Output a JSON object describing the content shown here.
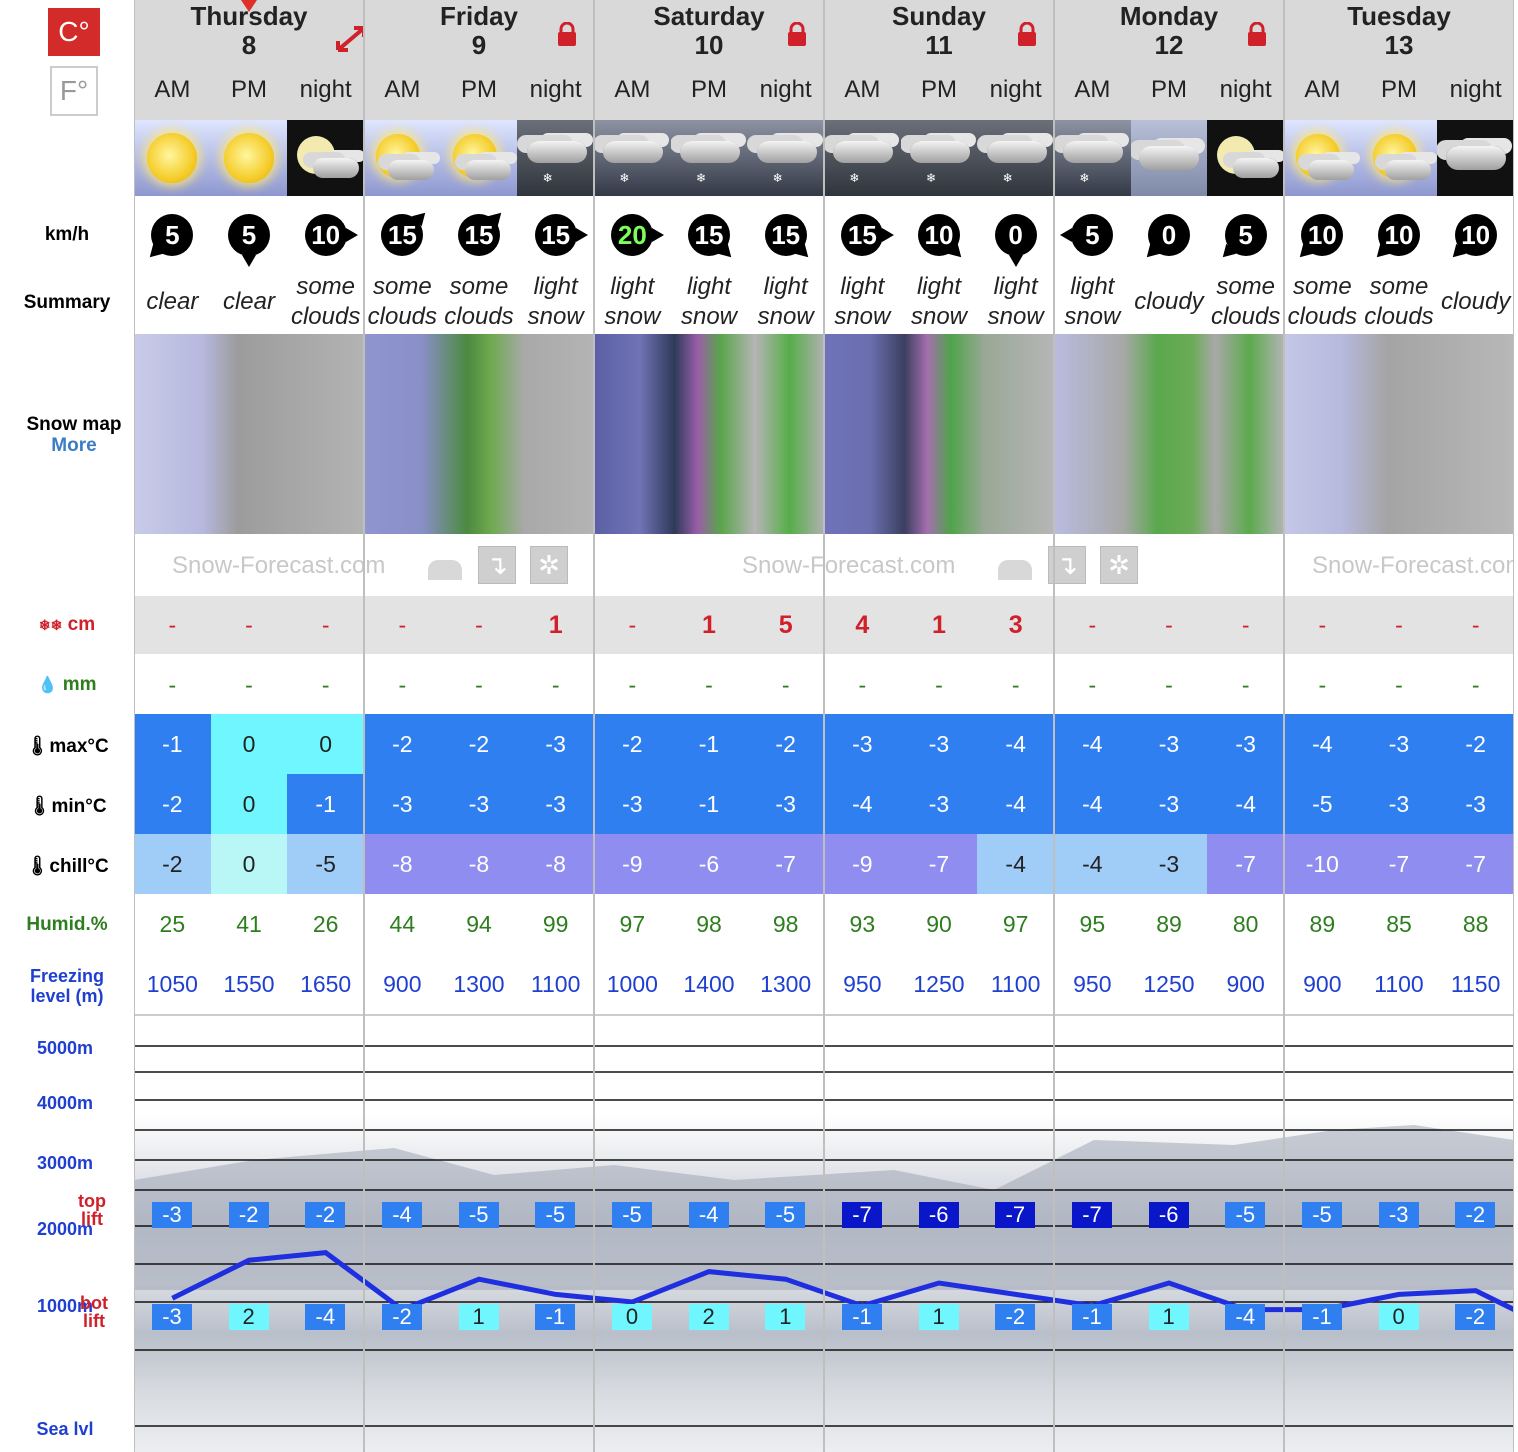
{
  "units": {
    "celsius": "C°",
    "fahrenheit": "F°"
  },
  "labels": {
    "wind": "km/h",
    "summary": "Summary",
    "snow_map": "Snow map",
    "more": "More",
    "snow_cm": "cm",
    "rain_mm": "mm",
    "max": "max°C",
    "min": "min°C",
    "chill": "chill°C",
    "humid": "Humid.%",
    "freezing_1": "Freezing",
    "freezing_2": "level (m)",
    "alt_5000": "5000m",
    "alt_4000": "4000m",
    "alt_3000": "3000m",
    "alt_2000": "2000m",
    "alt_1000": "1000m",
    "alt_sea": "Sea lvl",
    "top": "top",
    "lift": "lift",
    "bot": "bot",
    "bot_lift": "lift"
  },
  "watermark": "Snow-Forecast.com",
  "days": [
    {
      "name": "Thursday",
      "date": "8",
      "locked": false
    },
    {
      "name": "Friday",
      "date": "9",
      "locked": true
    },
    {
      "name": "Saturday",
      "date": "10",
      "locked": true
    },
    {
      "name": "Sunday",
      "date": "11",
      "locked": true
    },
    {
      "name": "Monday",
      "date": "12",
      "locked": true
    },
    {
      "name": "Tuesday",
      "date": "13",
      "locked": false
    }
  ],
  "periods": [
    "AM",
    "PM",
    "night"
  ],
  "weather_icons": [
    "sun-icon",
    "sun-icon",
    "moon-cloud-icon",
    "sun-cloud-icon",
    "sun-cloud-icon",
    "snow-cloud-icon",
    "snow-cloud-icon",
    "snow-cloud-icon",
    "snow-cloud-icon",
    "snow-cloud-icon",
    "snow-cloud-icon",
    "snow-cloud-icon",
    "snow-cloud-icon",
    "cloud-icon",
    "moon-cloud-icon",
    "sun-cloud-icon",
    "sun-cloud-icon",
    "cloud-icon"
  ],
  "wind": [
    {
      "speed": "5",
      "dir": "sw"
    },
    {
      "speed": "5",
      "dir": "s"
    },
    {
      "speed": "10",
      "dir": "e"
    },
    {
      "speed": "15",
      "dir": "ne"
    },
    {
      "speed": "15",
      "dir": "ne"
    },
    {
      "speed": "15",
      "dir": "e"
    },
    {
      "speed": "20",
      "dir": "e"
    },
    {
      "speed": "15",
      "dir": "se"
    },
    {
      "speed": "15",
      "dir": "se"
    },
    {
      "speed": "15",
      "dir": "e"
    },
    {
      "speed": "10",
      "dir": "se"
    },
    {
      "speed": "0",
      "dir": "s"
    },
    {
      "speed": "5",
      "dir": "w"
    },
    {
      "speed": "0",
      "dir": "sw"
    },
    {
      "speed": "5",
      "dir": "sw"
    },
    {
      "speed": "10",
      "dir": "sw"
    },
    {
      "speed": "10",
      "dir": "sw"
    },
    {
      "speed": "10",
      "dir": "sw"
    }
  ],
  "summary": [
    [
      "clear"
    ],
    [
      "clear"
    ],
    [
      "some",
      "clouds"
    ],
    [
      "some",
      "clouds"
    ],
    [
      "some",
      "clouds"
    ],
    [
      "light",
      "snow"
    ],
    [
      "light",
      "snow"
    ],
    [
      "light",
      "snow"
    ],
    [
      "light",
      "snow"
    ],
    [
      "light",
      "snow"
    ],
    [
      "light",
      "snow"
    ],
    [
      "light",
      "snow"
    ],
    [
      "light",
      "snow"
    ],
    [
      "cloudy"
    ],
    [
      "some",
      "clouds"
    ],
    [
      "some",
      "clouds"
    ],
    [
      "some",
      "clouds"
    ],
    [
      "cloudy"
    ]
  ],
  "snow_cm": [
    "-",
    "-",
    "-",
    "-",
    "-",
    "1",
    "-",
    "1",
    "5",
    "4",
    "1",
    "3",
    "-",
    "-",
    "-",
    "-",
    "-",
    "-"
  ],
  "rain_mm": [
    "-",
    "-",
    "-",
    "-",
    "-",
    "-",
    "-",
    "-",
    "-",
    "-",
    "-",
    "-",
    "-",
    "-",
    "-",
    "-",
    "-",
    "-"
  ],
  "max_c": [
    "-1",
    "0",
    "0",
    "-2",
    "-2",
    "-3",
    "-2",
    "-1",
    "-2",
    "-3",
    "-3",
    "-4",
    "-4",
    "-3",
    "-3",
    "-4",
    "-3",
    "-2"
  ],
  "min_c": [
    "-2",
    "0",
    "-1",
    "-3",
    "-3",
    "-3",
    "-3",
    "-1",
    "-3",
    "-4",
    "-3",
    "-4",
    "-4",
    "-3",
    "-4",
    "-5",
    "-3",
    "-3"
  ],
  "chill_c": [
    "-2",
    "0",
    "-5",
    "-8",
    "-8",
    "-8",
    "-9",
    "-6",
    "-7",
    "-9",
    "-7",
    "-4",
    "-4",
    "-3",
    "-7",
    "-10",
    "-7",
    "-7"
  ],
  "humid": [
    "25",
    "41",
    "26",
    "44",
    "94",
    "99",
    "97",
    "98",
    "98",
    "93",
    "90",
    "97",
    "95",
    "89",
    "80",
    "89",
    "85",
    "88"
  ],
  "freezing": [
    "1050",
    "1550",
    "1650",
    "900",
    "1300",
    "1100",
    "1000",
    "1400",
    "1300",
    "950",
    "1250",
    "1100",
    "950",
    "1250",
    "900",
    "900",
    "1100",
    "1150"
  ],
  "top_lift": [
    "-3",
    "-2",
    "-2",
    "-4",
    "-5",
    "-5",
    "-5",
    "-4",
    "-5",
    "-7",
    "-6",
    "-7",
    "-7",
    "-6",
    "-5",
    "-5",
    "-3",
    "-2"
  ],
  "bot_lift": [
    "-3",
    "2",
    "-4",
    "-2",
    "1",
    "-1",
    "0",
    "2",
    "1",
    "-1",
    "1",
    "-2",
    "-1",
    "1",
    "-4",
    "-1",
    "0",
    "-2"
  ],
  "colors": {
    "accent": "#d0202a",
    "sky_blue": "#2f7ff0",
    "cyan": "#6ff6ff",
    "lavender": "#8f8ef0",
    "light_blue": "#9fcdf8",
    "humid_green": "#2e7d1e",
    "freeze_blue": "#1f3fd0"
  }
}
